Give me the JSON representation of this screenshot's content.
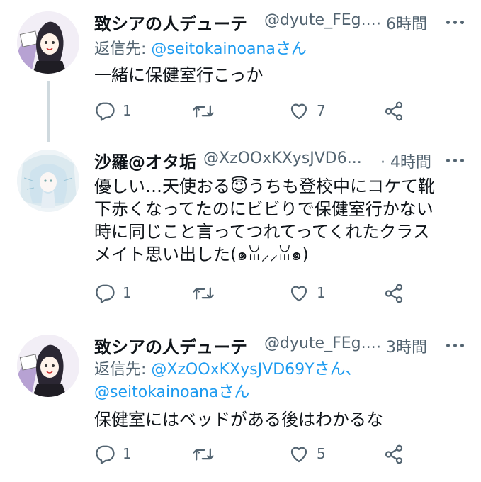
{
  "tweets": [
    {
      "name": "致シアの人デューテ",
      "handle": "@dyute_FEg...",
      "time": "· 6時間",
      "reply_label": "返信先: ",
      "reply_mentions": "@seitokainoana",
      "reply_suffix": "さん",
      "text": "一緒に保健室行こっか",
      "replies": "1",
      "retweets": "",
      "likes": "7"
    },
    {
      "name": "沙羅@オタ垢",
      "handle": "@XzOOxKXysJVD6...",
      "time": "· 4時間",
      "text_lines": [
        "優しい…天使おる😇うちも登校中にコケて靴",
        "下赤くなってたのにビビりで保健室行かない",
        "時に同じこと言ってつれてってくれたクラス",
        "メイト思い出した(๑ꈍ⸝⸝ꈍ๑)"
      ],
      "replies": "1",
      "retweets": "",
      "likes": "1"
    },
    {
      "name": "致シアの人デューテ",
      "handle": "@dyute_FEg...",
      "time": "· 3時間",
      "reply_label": "返信先: ",
      "reply_line1_mention": "@XzOOxKXysJVD69Y",
      "reply_line1_suffix": "さん、",
      "reply_line2_mention": "@seitokainoana",
      "reply_line2_suffix": "さん",
      "text": "保健室にはベッドがある後はわかるな",
      "replies": "1",
      "retweets": "",
      "likes": "5"
    }
  ],
  "colors": {
    "secondary": "#536471",
    "link": "#1d9bf0",
    "line": "#cfd9de"
  },
  "icons": [
    "reply-icon",
    "retweet-icon",
    "like-icon",
    "share-icon",
    "more-icon"
  ]
}
